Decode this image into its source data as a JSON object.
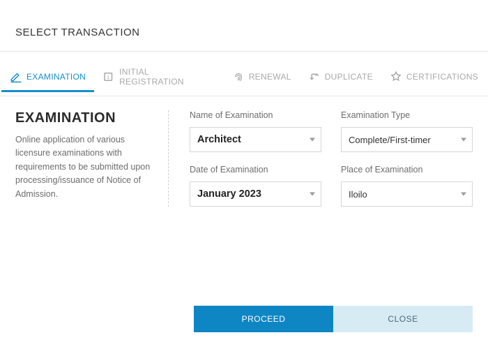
{
  "title": "SELECT TRANSACTION",
  "tabs": [
    {
      "label": "EXAMINATION"
    },
    {
      "label": "INITIAL REGISTRATION"
    },
    {
      "label": "RENEWAL"
    },
    {
      "label": "DUPLICATE"
    },
    {
      "label": "CERTIFICATIONS"
    }
  ],
  "panel": {
    "heading": "EXAMINATION",
    "description": "Online application of various licensure examinations with requirements to be submitted upon processing/issuance of Notice of Admission."
  },
  "form": {
    "name_of_examination": {
      "label": "Name of Examination",
      "value": "Architect"
    },
    "examination_type": {
      "label": "Examination Type",
      "value": "Complete/First-timer"
    },
    "date_of_examination": {
      "label": "Date of Examination",
      "value": "January 2023"
    },
    "place_of_examination": {
      "label": "Place of Examination",
      "value": "Iloilo"
    }
  },
  "buttons": {
    "proceed": "PROCEED",
    "close": "CLOSE"
  }
}
